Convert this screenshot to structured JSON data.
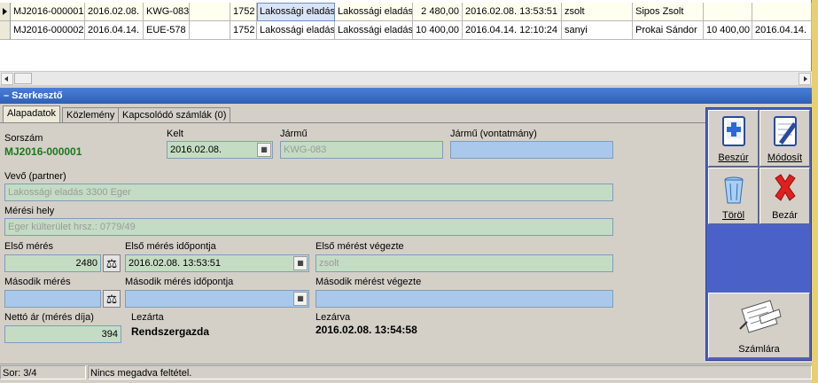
{
  "grid": {
    "rows": [
      {
        "current": true,
        "cells": [
          "MJ2016-000001",
          "2016.02.08.",
          "KWG-083",
          "",
          "1752",
          "Lakossági eladás",
          "Lakossági eladás",
          "2 480,00",
          "2016.02.08. 13:53:51",
          "zsolt",
          "",
          "Sipos Zsolt",
          "",
          ""
        ]
      },
      {
        "current": false,
        "cells": [
          "MJ2016-000002",
          "2016.04.14.",
          "EUE-578",
          "",
          "1752",
          "Lakossági eladás",
          "Lakossági eladás",
          "10 400,00",
          "2016.04.14. 12:10:24",
          "sanyi",
          "",
          "Prokai Sándor",
          "10 400,00",
          "2016.04.14."
        ]
      }
    ]
  },
  "panel": {
    "title": "– Szerkesztő"
  },
  "tabs": [
    "Alapadatok",
    "Közlemény",
    "Kapcsolódó számlák (0)"
  ],
  "form": {
    "sorszam_label": "Sorszám",
    "sorszam_value": "MJ2016-000001",
    "kelt_label": "Kelt",
    "kelt_value": "2016.02.08.",
    "jarmu_label": "Jármű",
    "jarmu_value": "KWG-083",
    "jarmu_vont_label": "Jármű (vontatmány)",
    "jarmu_vont_value": "",
    "vevo_label": "Vevő (partner)",
    "vevo_value": "Lakossági eladás 3300 Eger",
    "meresi_hely_label": "Mérési hely",
    "meresi_hely_value": "Eger  külterület hrsz.: 0779/49",
    "elso_meres_label": "Első mérés",
    "elso_meres_value": "2480",
    "elso_meres_idopont_label": "Első mérés időpontja",
    "elso_meres_idopont_value": "2016.02.08. 13:53:51",
    "elso_meres_vegezte_label": "Első mérést végezte",
    "elso_meres_vegezte_value": "zsolt",
    "masodik_meres_label": "Második mérés",
    "masodik_meres_value": "",
    "masodik_meres_idopont_label": "Második mérés időpontja",
    "masodik_meres_idopont_value": "",
    "masodik_meres_vegezte_label": "Második mérést végezte",
    "masodik_meres_vegezte_value": "",
    "netto_ar_label": "Nettó ár (mérés díja)",
    "netto_ar_value": "394",
    "lezarta_label": "Lezárta",
    "lezarta_value": "Rendszergazda",
    "lezarva_label": "Lezárva",
    "lezarva_value": "2016.02.08. 13:54:58"
  },
  "toolbar": {
    "beszur": "Beszúr",
    "modosit": "Módosít",
    "torol": "Töröl",
    "bezar": "Bezár",
    "szamlara": "Számlára"
  },
  "status": {
    "record": "Sor: 3/4",
    "filter": "Nincs megadva feltétel."
  },
  "colors": {
    "panel_header": "#2f5fb8",
    "toolbar_bg": "#4a62c8",
    "field_green": "#c4dcc4",
    "field_blue": "#aac8ec",
    "sorszam_green": "#1a7a1a"
  }
}
